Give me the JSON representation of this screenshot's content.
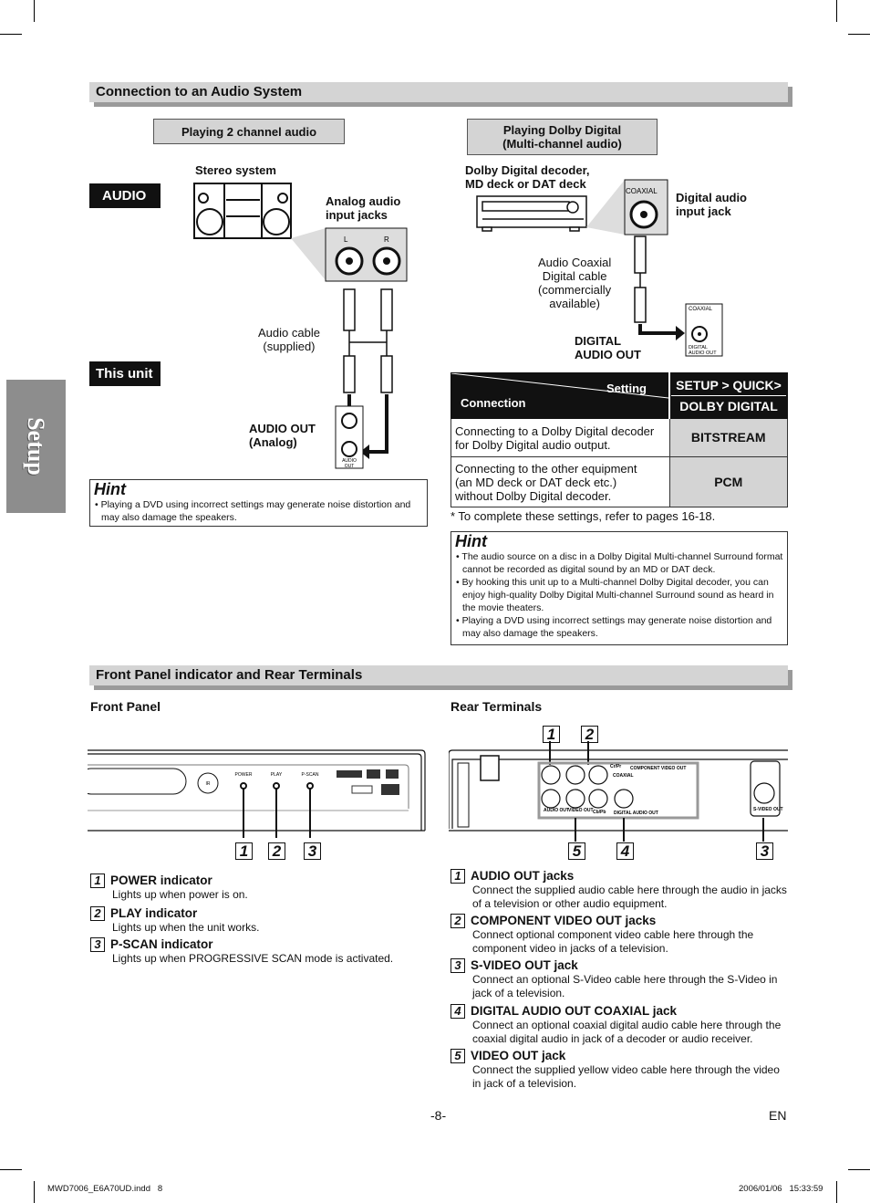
{
  "side_tab": "Setup",
  "section1": {
    "title": "Connection to an Audio System"
  },
  "left": {
    "mode": "Playing 2 channel audio",
    "audio_label": "AUDIO",
    "unit_label": "This unit",
    "stereo": "Stereo system",
    "analog_jacks": "Analog audio\ninput jacks",
    "jack_l": "L",
    "jack_r": "R",
    "cable": "Audio cable\n(supplied)",
    "audio_out": "AUDIO OUT\n(Analog)",
    "out_jack_label": "AUDIO\nOUT",
    "hint": {
      "title": "Hint",
      "items": [
        "• Playing a DVD using incorrect settings may generate noise distortion and may also damage the speakers."
      ]
    }
  },
  "right": {
    "mode": "Playing Dolby Digital\n(Multi-channel audio)",
    "decoder": "Dolby Digital decoder,\nMD deck or DAT deck",
    "coaxial": "COAXIAL",
    "digital_input": "Digital audio\ninput jack",
    "cable": "Audio Coaxial\nDigital cable\n(commercially\navailable)",
    "digital_out": "DIGITAL\nAUDIO OUT",
    "out_jack_top": "COAXIAL",
    "out_jack_bottom": "DIGITAL\nAUDIO OUT",
    "table": {
      "header_setting": "Setting",
      "header_connection": "Connection",
      "header_path": "SETUP > QUICK>",
      "header_item": "DOLBY DIGITAL",
      "rows": [
        {
          "connection": "Connecting to a Dolby Digital decoder\nfor Dolby Digital audio output.",
          "value": "BITSTREAM"
        },
        {
          "connection": "Connecting to the other equipment\n(an MD deck or DAT deck etc.)\nwithout Dolby Digital decoder.",
          "value": "PCM"
        }
      ]
    },
    "note": "* To complete these settings, refer to pages 16-18.",
    "hint": {
      "title": "Hint",
      "items": [
        "• The audio source on a disc in a Dolby Digital Multi-channel Surround format cannot be recorded as digital sound by an MD or DAT deck.",
        "• By hooking this unit up to a Multi-channel Dolby Digital decoder, you can enjoy high-quality Dolby Digital Multi-channel Surround sound as heard in the movie theaters.",
        "• Playing a DVD using incorrect settings may generate noise distortion and may also damage the speakers."
      ]
    }
  },
  "section2": {
    "title": "Front Panel indicator and Rear Terminals"
  },
  "front": {
    "title": "Front Panel",
    "panel_labels": {
      "ir": "IR",
      "power": "POWER",
      "play": "PLAY",
      "pscan": "P-SCAN"
    },
    "callouts": [
      "1",
      "2",
      "3"
    ],
    "items": [
      {
        "n": "1",
        "title": "POWER indicator",
        "desc": "Lights up when power is on."
      },
      {
        "n": "2",
        "title": "PLAY indicator",
        "desc": "Lights up when the unit works."
      },
      {
        "n": "3",
        "title": "P-SCAN indicator",
        "desc": "Lights up when PROGRESSIVE SCAN mode is activated."
      }
    ]
  },
  "rear": {
    "title": "Rear Terminals",
    "panel_labels": {
      "component": "COMPONENT  VIDEO OUT",
      "crpr": "Cr/Pr",
      "cbpb": "Cb/Pb",
      "coaxial": "COAXIAL",
      "audio_out": "AUDIO OUT",
      "video_out": "VIDEO OUT",
      "digital": "DIGITAL AUDIO OUT",
      "svideo": "S-VIDEO OUT"
    },
    "callouts": [
      "1",
      "2",
      "5",
      "4",
      "3"
    ],
    "items": [
      {
        "n": "1",
        "title": "AUDIO OUT jacks",
        "desc": "Connect the supplied audio cable here through the audio in jacks of a television or other audio equipment."
      },
      {
        "n": "2",
        "title": "COMPONENT VIDEO OUT jacks",
        "desc": "Connect optional component video cable here through the component video in jacks of a television."
      },
      {
        "n": "3",
        "title": "S-VIDEO OUT jack",
        "desc": "Connect an optional S-Video cable here through the S-Video in jack of a television."
      },
      {
        "n": "4",
        "title": "DIGITAL AUDIO OUT COAXIAL jack",
        "desc": "Connect an optional coaxial digital audio cable here through the coaxial digital audio in jack of a decoder or audio receiver."
      },
      {
        "n": "5",
        "title": "VIDEO OUT jack",
        "desc": "Connect the supplied yellow video cable here through the video in jack of a television."
      }
    ]
  },
  "footer": {
    "page": "-8-",
    "lang": "EN",
    "file": "MWD7006_E6A70UD.indd   8",
    "stamp": "2006/01/06   15:33:59"
  }
}
